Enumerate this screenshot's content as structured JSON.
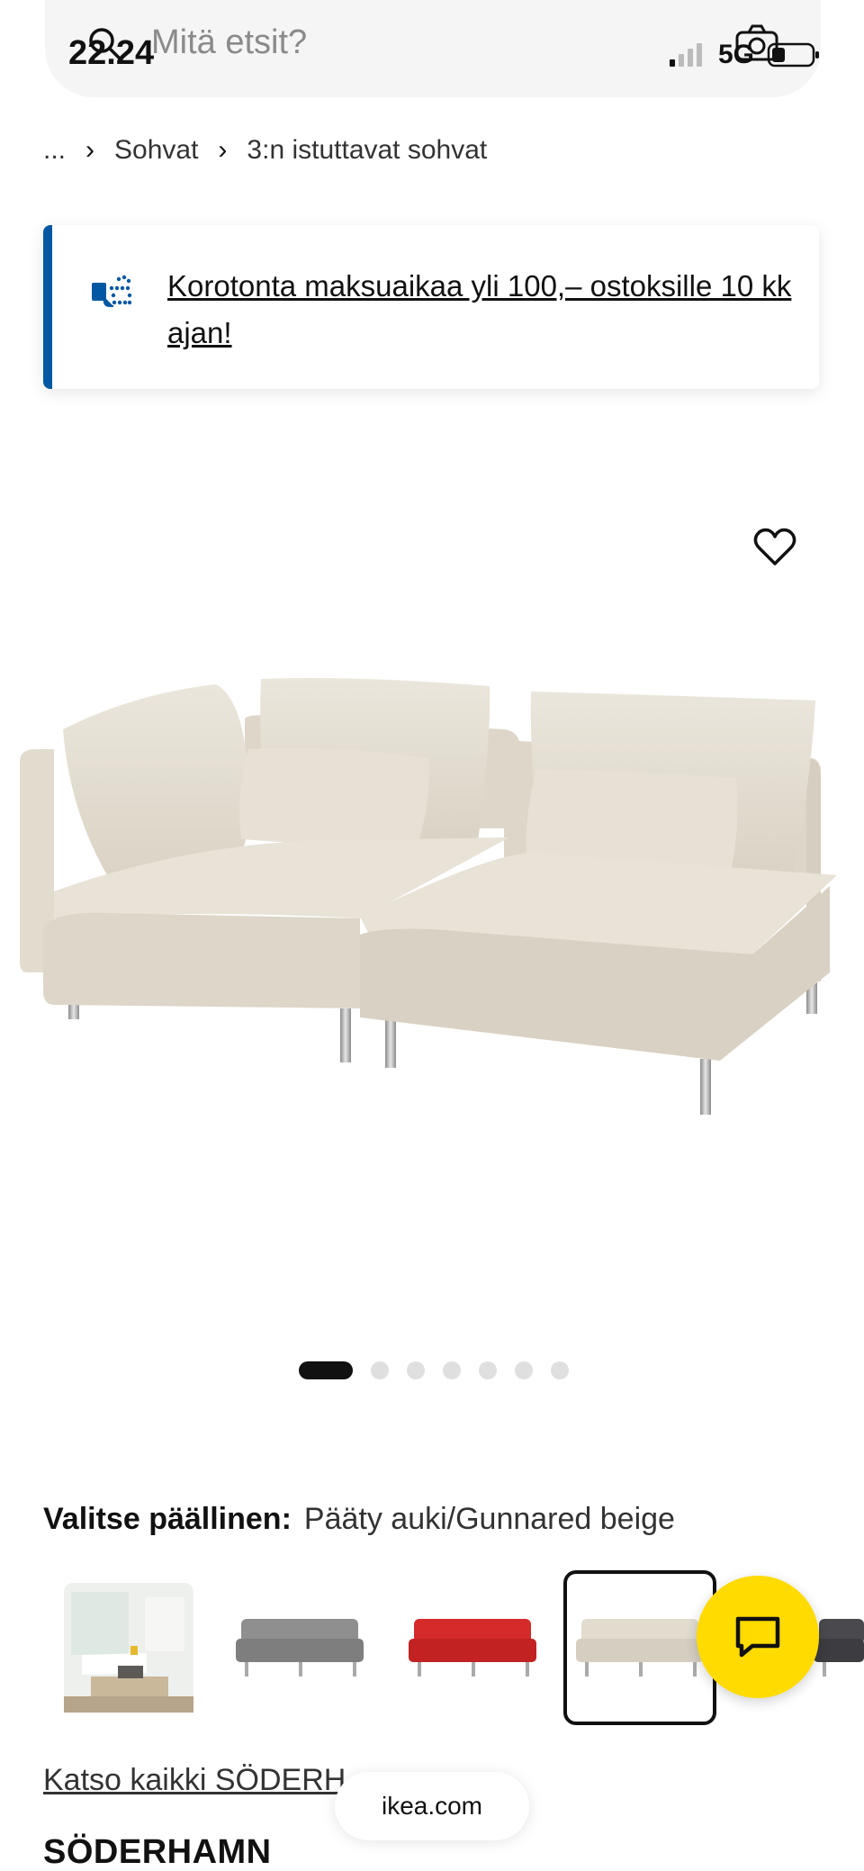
{
  "status_bar": {
    "time": "22.24",
    "network": "5G"
  },
  "search": {
    "placeholder": "Mitä etsit?"
  },
  "breadcrumb": {
    "items": [
      "...",
      "Sohvat",
      "3:n istuttavat sohvat"
    ],
    "separator": "›"
  },
  "banner": {
    "text": "Korotonta maksuaikaa yli 100,– ostoksille 10 kk ajan!"
  },
  "gallery": {
    "image_count": 7,
    "active_index": 0
  },
  "cover": {
    "label": "Valitse päällinen:",
    "value": "Pääty auki/Gunnared beige",
    "options": [
      {
        "color": "#eef0ee",
        "kind": "room-photo",
        "selected": false
      },
      {
        "color": "#8f8f8f",
        "kind": "sofa",
        "selected": false
      },
      {
        "color": "#d42a2a",
        "kind": "sofa",
        "selected": false
      },
      {
        "color": "#ddd6c9",
        "kind": "sofa",
        "selected": true
      },
      {
        "color": "#4a4a4e",
        "kind": "sofa",
        "selected": false
      }
    ]
  },
  "see_all": {
    "label": "Katso kaikki SÖDERH"
  },
  "browser": {
    "url": "ikea.com"
  },
  "product": {
    "name": "SÖDERHAMN"
  },
  "colors": {
    "ikea_blue": "#0058a3",
    "ikea_yellow": "#ffdb00",
    "sofa_fabric": "#e3ddd2"
  }
}
